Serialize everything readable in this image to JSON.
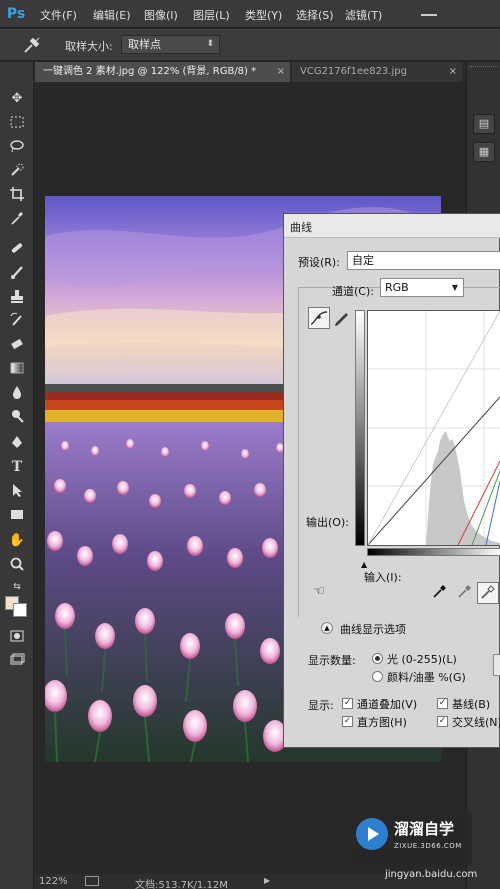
{
  "app": {
    "logo": "Ps"
  },
  "menu": {
    "items": [
      "文件(F)",
      "编辑(E)",
      "图像(I)",
      "图层(L)",
      "类型(Y)",
      "选择(S)",
      "滤镜(T)"
    ]
  },
  "options_bar": {
    "tool_icon": "eyedropper-icon",
    "sample_size_label": "取样大小:",
    "sample_size_value": "取样点"
  },
  "tabs": [
    {
      "label": "一键调色 2 素材.jpg @ 122% (背景, RGB/8) *",
      "active": true,
      "close": "×"
    },
    {
      "label": "VCG2176f1ee823.jpg",
      "active": false,
      "close": "×"
    }
  ],
  "tools": [
    "move-icon",
    "marquee-icon",
    "lasso-icon",
    "quick-select-icon",
    "crop-icon",
    "eyedropper-icon",
    "healing-icon",
    "brush-icon",
    "stamp-icon",
    "history-brush-icon",
    "eraser-icon",
    "gradient-icon",
    "blur-icon",
    "dodge-icon",
    "pen-icon",
    "type-icon",
    "path-select-icon",
    "rectangle-icon",
    "hand-icon",
    "zoom-icon"
  ],
  "colors": {
    "foreground": "#f2e1c7",
    "background": "#ffffff",
    "accent": "#3aa3e3"
  },
  "curves": {
    "title": "曲线",
    "preset_label": "预设(R):",
    "preset_value": "自定",
    "channel_label": "通道(C):",
    "channel_value": "RGB",
    "output_label": "输出(O):",
    "input_label": "输入(I):",
    "options_toggle": "曲线显示选项",
    "show_amount_label": "显示数量:",
    "light_option": "光 (0-255)(L)",
    "pigment_option": "颜料/油墨 %(G)",
    "show_label": "显示:",
    "checkbox_channel_overlays": "通道叠加(V)",
    "checkbox_baseline": "基线(B)",
    "checkbox_histogram": "直方图(H)",
    "checkbox_intersection": "交叉线(N)"
  },
  "status": {
    "zoom": "122%",
    "doc_info": "文档:513.7K/1.12M",
    "arrow": "▶"
  },
  "watermark": {
    "title": "溜溜自学",
    "url": "ZIXUE.3D66.COM",
    "site": "jingyan.baidu.com"
  }
}
